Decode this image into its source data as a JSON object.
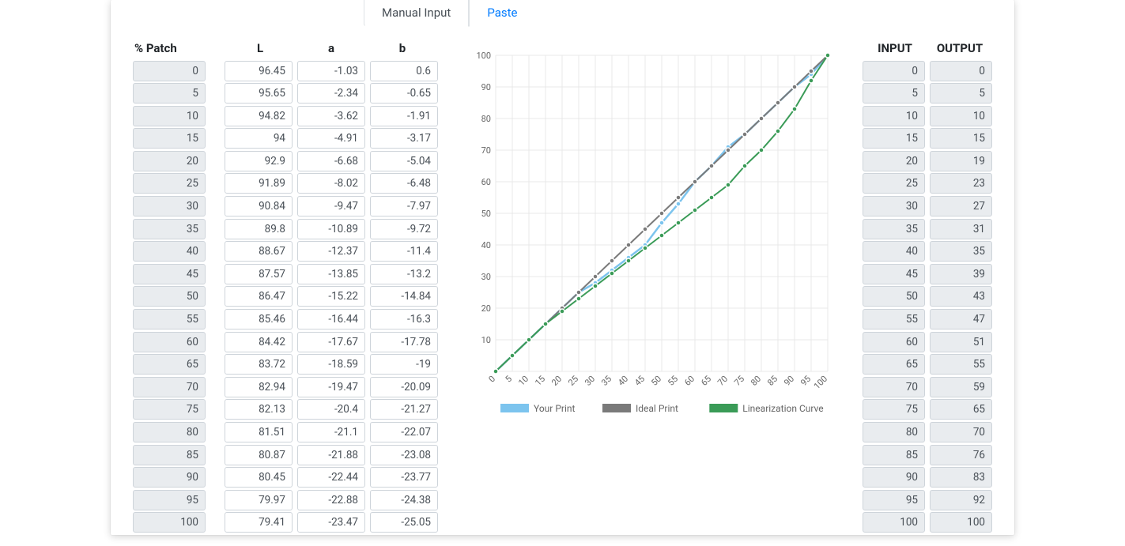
{
  "tabs": {
    "manual": "Manual Input",
    "paste": "Paste"
  },
  "headers": {
    "patch": "% Patch",
    "L": "L",
    "a": "a",
    "b": "b",
    "input": "INPUT",
    "output": "OUTPUT"
  },
  "patches": [
    {
      "p": 0,
      "L": 96.45,
      "a": -1.03,
      "b": 0.6
    },
    {
      "p": 5,
      "L": 95.65,
      "a": -2.34,
      "b": -0.65
    },
    {
      "p": 10,
      "L": 94.82,
      "a": -3.62,
      "b": -1.91
    },
    {
      "p": 15,
      "L": 94,
      "a": -4.91,
      "b": -3.17
    },
    {
      "p": 20,
      "L": 92.9,
      "a": -6.68,
      "b": -5.04
    },
    {
      "p": 25,
      "L": 91.89,
      "a": -8.02,
      "b": -6.48
    },
    {
      "p": 30,
      "L": 90.84,
      "a": -9.47,
      "b": -7.97
    },
    {
      "p": 35,
      "L": 89.8,
      "a": -10.89,
      "b": -9.72
    },
    {
      "p": 40,
      "L": 88.67,
      "a": -12.37,
      "b": -11.4
    },
    {
      "p": 45,
      "L": 87.57,
      "a": -13.85,
      "b": -13.2
    },
    {
      "p": 50,
      "L": 86.47,
      "a": -15.22,
      "b": -14.84
    },
    {
      "p": 55,
      "L": 85.46,
      "a": -16.44,
      "b": -16.3
    },
    {
      "p": 60,
      "L": 84.42,
      "a": -17.67,
      "b": -17.78
    },
    {
      "p": 65,
      "L": 83.72,
      "a": -18.59,
      "b": -19
    },
    {
      "p": 70,
      "L": 82.94,
      "a": -19.47,
      "b": -20.09
    },
    {
      "p": 75,
      "L": 82.13,
      "a": -20.4,
      "b": -21.27
    },
    {
      "p": 80,
      "L": 81.51,
      "a": -21.1,
      "b": -22.07
    },
    {
      "p": 85,
      "L": 80.87,
      "a": -21.88,
      "b": -23.08
    },
    {
      "p": 90,
      "L": 80.45,
      "a": -22.44,
      "b": -23.77
    },
    {
      "p": 95,
      "L": 79.97,
      "a": -22.88,
      "b": -24.38
    },
    {
      "p": 100,
      "L": 79.41,
      "a": -23.47,
      "b": -25.05
    }
  ],
  "io": [
    {
      "in": 0,
      "out": 0
    },
    {
      "in": 5,
      "out": 5
    },
    {
      "in": 10,
      "out": 10
    },
    {
      "in": 15,
      "out": 15
    },
    {
      "in": 20,
      "out": 19
    },
    {
      "in": 25,
      "out": 23
    },
    {
      "in": 30,
      "out": 27
    },
    {
      "in": 35,
      "out": 31
    },
    {
      "in": 40,
      "out": 35
    },
    {
      "in": 45,
      "out": 39
    },
    {
      "in": 50,
      "out": 43
    },
    {
      "in": 55,
      "out": 47
    },
    {
      "in": 60,
      "out": 51
    },
    {
      "in": 65,
      "out": 55
    },
    {
      "in": 70,
      "out": 59
    },
    {
      "in": 75,
      "out": 65
    },
    {
      "in": 80,
      "out": 70
    },
    {
      "in": 85,
      "out": 76
    },
    {
      "in": 90,
      "out": 83
    },
    {
      "in": 95,
      "out": 92
    },
    {
      "in": 100,
      "out": 100
    }
  ],
  "chart_data": {
    "type": "line",
    "x": [
      0,
      5,
      10,
      15,
      20,
      25,
      30,
      35,
      40,
      45,
      50,
      55,
      60,
      65,
      70,
      75,
      80,
      85,
      90,
      95,
      100
    ],
    "xlim": [
      0,
      100
    ],
    "ylim": [
      0,
      100
    ],
    "xlabel": "",
    "ylabel": "",
    "legend": [
      "Your Print",
      "Ideal Print",
      "Linearization Curve"
    ],
    "colors": {
      "your_print": "#7cc4ee",
      "ideal": "#7a7a7a",
      "linearization": "#3a9b57"
    },
    "series": [
      {
        "name": "Your Print",
        "values": [
          0,
          5,
          10,
          15,
          20,
          25,
          28,
          32,
          36,
          40,
          47,
          53,
          60,
          65,
          71,
          75,
          80,
          85,
          90,
          94,
          100
        ]
      },
      {
        "name": "Ideal Print",
        "values": [
          0,
          5,
          10,
          15,
          20,
          25,
          30,
          35,
          40,
          45,
          50,
          55,
          60,
          65,
          70,
          75,
          80,
          85,
          90,
          95,
          100
        ]
      },
      {
        "name": "Linearization Curve",
        "values": [
          0,
          5,
          10,
          15,
          19,
          23,
          27,
          31,
          35,
          39,
          43,
          47,
          51,
          55,
          59,
          65,
          70,
          76,
          83,
          92,
          100
        ]
      }
    ]
  }
}
